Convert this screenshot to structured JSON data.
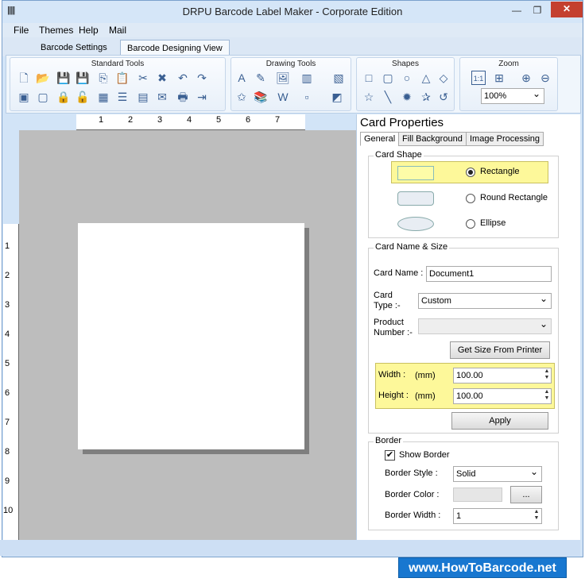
{
  "window": {
    "title": "DRPU Barcode Label Maker - Corporate Edition",
    "min": "—",
    "restore": "❐",
    "close": "✕"
  },
  "menu": [
    "File",
    "Themes",
    "Help",
    "Mail"
  ],
  "tabs": [
    {
      "label": "Barcode Settings"
    },
    {
      "label": "Barcode Designing View"
    }
  ],
  "ribbon": {
    "standard_tools": "Standard Tools",
    "drawing_tools": "Drawing Tools",
    "shapes": "Shapes",
    "zoom": "Zoom",
    "zoom_value": "100%",
    "zoom_fit": "1:1"
  },
  "ruler": {
    "h": [
      "1",
      "2",
      "3",
      "4",
      "5",
      "6",
      "7"
    ],
    "v": [
      "1",
      "2",
      "3",
      "4",
      "5",
      "6",
      "7",
      "8",
      "9",
      "10"
    ]
  },
  "props": {
    "heading": "Card Properties",
    "tabs": [
      "General",
      "Fill Background",
      "Image Processing"
    ],
    "card_shape": {
      "legend": "Card Shape",
      "rect": "Rectangle",
      "round": "Round Rectangle",
      "ellipse": "Ellipse"
    },
    "name_size": {
      "legend": "Card  Name & Size",
      "card_name_label": "Card Name :",
      "card_name_value": "Document1",
      "card_type_label1": "Card",
      "card_type_label2": "Type :-",
      "card_type_value": "Custom",
      "product_label1": "Product",
      "product_label2": "Number :-",
      "get_size_btn": "Get Size From Printer",
      "width_label": "Width :",
      "height_label": "Height :",
      "unit": "(mm)",
      "width_value": "100.00",
      "height_value": "100.00",
      "apply_btn": "Apply"
    },
    "border": {
      "legend": "Border",
      "show_border": "Show Border",
      "style_label": "Border Style :",
      "style_value": "Solid",
      "color_label": "Border Color :",
      "color_btn": "...",
      "width_label": "Border Width :",
      "width_value": "1"
    }
  },
  "website": "www.HowToBarcode.net"
}
